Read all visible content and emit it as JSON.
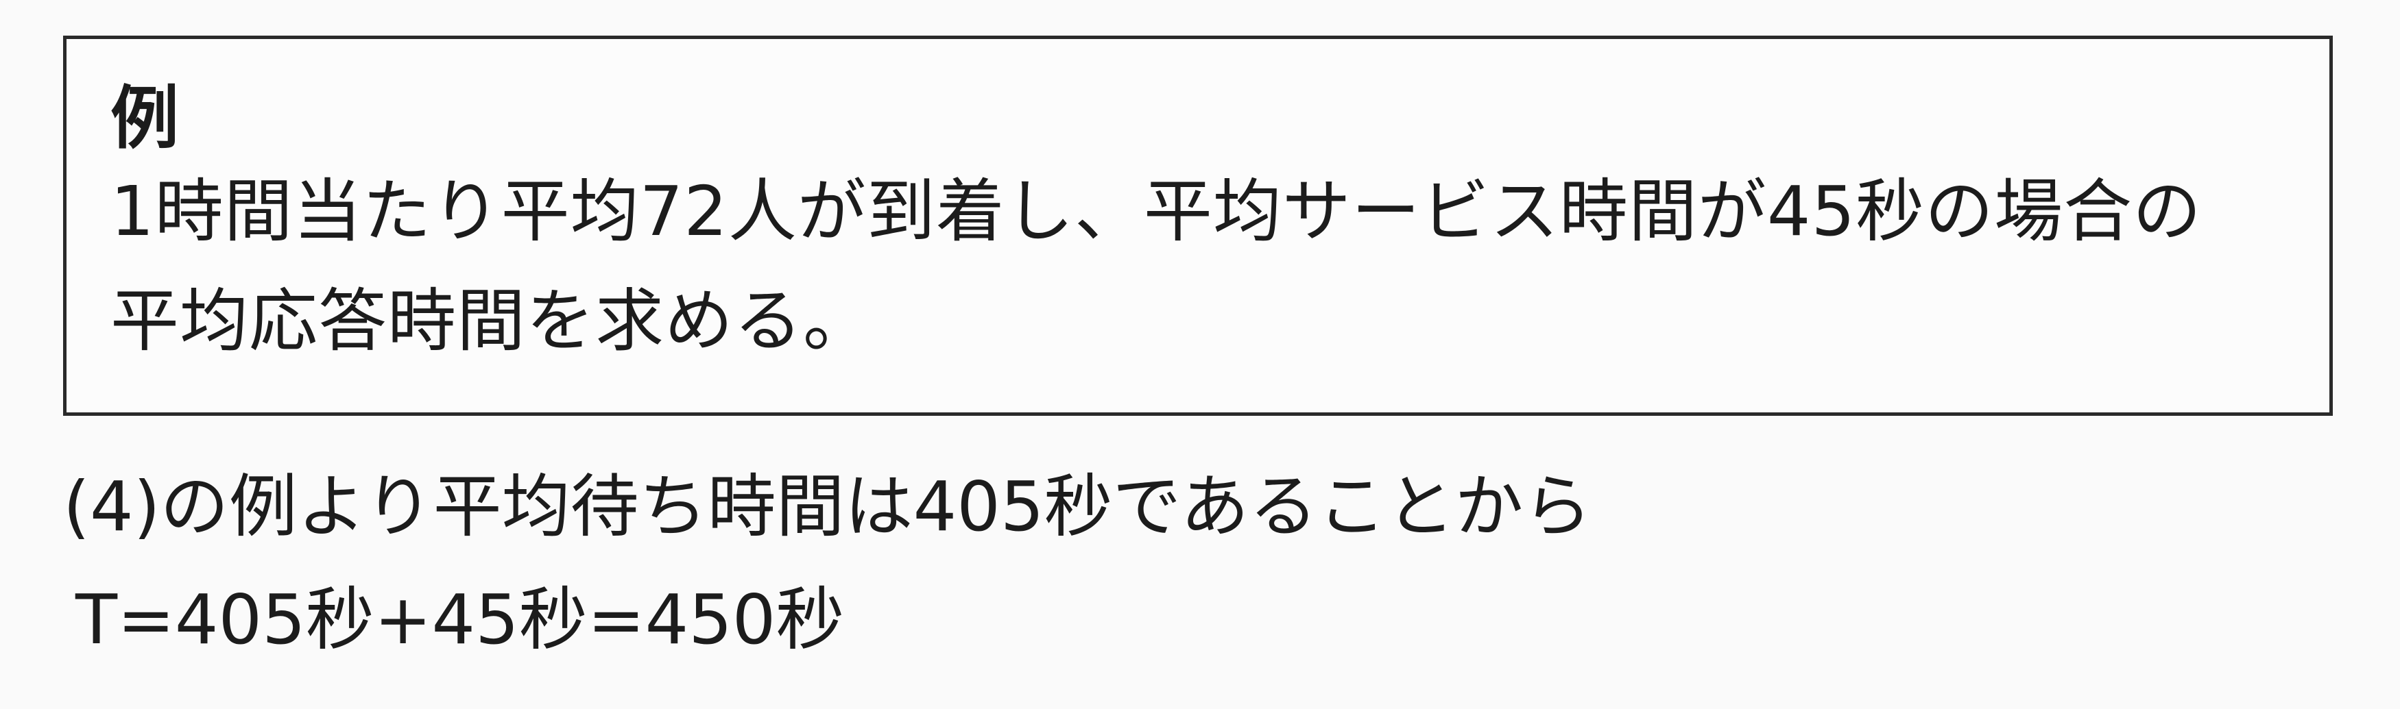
{
  "example": {
    "heading": "例",
    "text": "1時間当たり平均72人が到着し、平均サービス時間が45秒の場合の平均応答時間を求める。"
  },
  "solution": {
    "explanation": "(4)の例より平均待ち時間は405秒であることから",
    "formula": "T=405秒+45秒=450秒"
  }
}
